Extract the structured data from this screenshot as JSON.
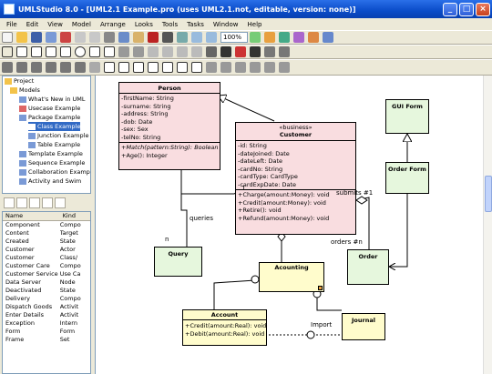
{
  "window": {
    "title": "UMLStudio 8.0 - [UML2.1 Example.pro (uses UML2.1.not, editable, version: none)]"
  },
  "menu": [
    "File",
    "Edit",
    "View",
    "Model",
    "Arrange",
    "Looks",
    "Tools",
    "Tasks",
    "Window",
    "Help"
  ],
  "toolbar": {
    "zoom": "100%"
  },
  "tree": [
    {
      "label": "Project",
      "indent": 0
    },
    {
      "label": "Models",
      "indent": 1
    },
    {
      "label": "What's New in UML",
      "indent": 2
    },
    {
      "label": "Usecase Example",
      "indent": 2
    },
    {
      "label": "Package Example",
      "indent": 2
    },
    {
      "label": "Class Example",
      "indent": 3
    },
    {
      "label": "Junction Example",
      "indent": 3
    },
    {
      "label": "Table Example",
      "indent": 3
    },
    {
      "label": "Template Example",
      "indent": 2
    },
    {
      "label": "Sequence Example",
      "indent": 2
    },
    {
      "label": "Collaboration Example",
      "indent": 2
    },
    {
      "label": "Activity and Swim",
      "indent": 2
    }
  ],
  "properties": {
    "headers": [
      "Name",
      "Kind"
    ],
    "rows": [
      [
        "Component",
        "Compo"
      ],
      [
        "Content",
        "Target"
      ],
      [
        "Created",
        "State"
      ],
      [
        "Customer",
        "Actor"
      ],
      [
        "Customer",
        "Class/"
      ],
      [
        "Customer Care",
        "Compo"
      ],
      [
        "Customer Service",
        "Use Ca"
      ],
      [
        "Data Server",
        "Node"
      ],
      [
        "Deactivated",
        "State"
      ],
      [
        "Delivery",
        "Compo"
      ],
      [
        "Dispatch Goods",
        "Activit"
      ],
      [
        "Enter Details",
        "Activit"
      ],
      [
        "Exception",
        "Intern"
      ],
      [
        "Form",
        "Form"
      ],
      [
        "Frame",
        "Set"
      ]
    ]
  },
  "diagram": {
    "person": {
      "name": "Person",
      "attrs": [
        "-firstName: String",
        "-surname: String",
        "-address: String",
        "-dob: Date",
        "-sex: Sex",
        "-telNo: String"
      ],
      "ops": [
        "+Match(pattern:String): Boolean",
        "+Age(): Integer"
      ]
    },
    "customer": {
      "stereotype": "«business»",
      "name": "Customer",
      "attrs": [
        "-id: String",
        "-dateJoined: Date",
        "-dateLeft: Date",
        "-cardNo: String",
        "-cardType: CardType",
        "-cardExpDate: Date"
      ],
      "ops": [
        "+Charge(amount:Money): void",
        "+Credit(amount:Money): void",
        "+Retire(): void",
        "+Refund(amount:Money): void"
      ]
    },
    "gui_form": "GUI Form",
    "order_form": "Order Form",
    "query": "Query",
    "order": "Order",
    "accounting": "Acounting",
    "account": {
      "name": "Account",
      "ops": [
        "+Credit(amount:Real): void",
        "+Debit(amount:Real): void"
      ]
    },
    "journal": "Journal",
    "labels": {
      "queries": "queries",
      "n": "n",
      "one": "1",
      "submits": "submits #1",
      "orders": "orders #n",
      "import": "Import"
    }
  }
}
